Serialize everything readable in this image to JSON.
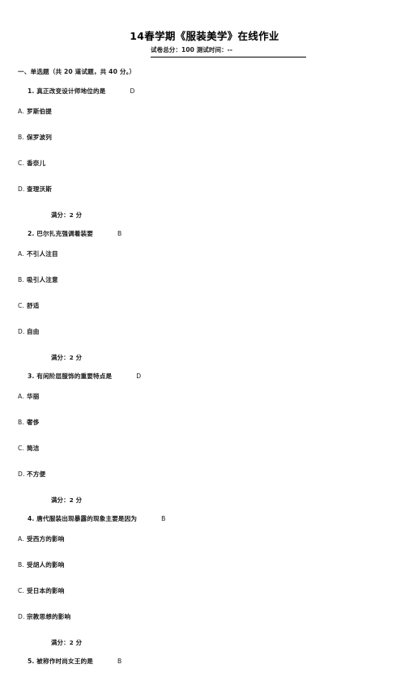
{
  "document": {
    "title": "14春学期《服装美学》在线作业",
    "meta": "试卷总分：100 测试时间：--",
    "section_heading": "一、单选题（共 20 道试题，共 40 分。）",
    "score_label": "满分：2 分",
    "questions": [
      {
        "number": "1.",
        "text": "真正改变设计师地位的是",
        "answer": "D",
        "options": [
          {
            "letter": "A.",
            "text": "罗斯伯提"
          },
          {
            "letter": "B.",
            "text": "保罗波列"
          },
          {
            "letter": "C.",
            "text": "香奈儿"
          },
          {
            "letter": "D.",
            "text": "查理沃斯"
          }
        ],
        "score": "满分：2 分"
      },
      {
        "number": "2.",
        "text": "巴尔扎克强调着装要",
        "answer": "B",
        "options": [
          {
            "letter": "A.",
            "text": "不引人注目"
          },
          {
            "letter": "B.",
            "text": "吸引人注意"
          },
          {
            "letter": "C.",
            "text": "舒适"
          },
          {
            "letter": "D.",
            "text": "自由"
          }
        ],
        "score": "满分：2 分"
      },
      {
        "number": "3.",
        "text": "有闲阶层服饰的重要特点是",
        "answer": "D",
        "options": [
          {
            "letter": "A.",
            "text": "华丽"
          },
          {
            "letter": "B.",
            "text": "奢侈"
          },
          {
            "letter": "C.",
            "text": "简洁"
          },
          {
            "letter": "D.",
            "text": "不方便"
          }
        ],
        "score": "满分：2 分"
      },
      {
        "number": "4.",
        "text": "唐代服装出现暴露的现象主要是因为",
        "answer": "B",
        "options": [
          {
            "letter": "A.",
            "text": "受西方的影响"
          },
          {
            "letter": "B.",
            "text": "受胡人的影响"
          },
          {
            "letter": "C.",
            "text": "受日本的影响"
          },
          {
            "letter": "D.",
            "text": "宗教思想的影响"
          }
        ],
        "score": "满分：2 分"
      },
      {
        "number": "5.",
        "text": "被称作时尚女王的是",
        "answer": "B",
        "options": [],
        "score": ""
      }
    ]
  }
}
